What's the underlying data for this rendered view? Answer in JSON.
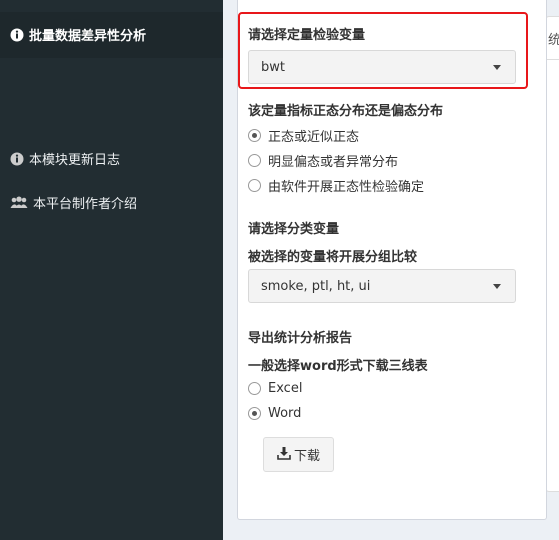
{
  "sidebar": {
    "items": [
      {
        "label": "批量数据差异性分析",
        "icon": "info-circle-icon"
      },
      {
        "label": "本模块更新日志",
        "icon": "info-circle-icon"
      },
      {
        "label": "本平台制作者介绍",
        "icon": "users-icon"
      }
    ]
  },
  "right_panel": {
    "tab_label": "统"
  },
  "quant_var": {
    "label": "请选择定量检验变量",
    "value": "bwt"
  },
  "distribution": {
    "label": "该定量指标正态分布还是偏态分布",
    "options": [
      {
        "label": "正态或近似正态",
        "checked": true
      },
      {
        "label": "明显偏态或者异常分布",
        "checked": false
      },
      {
        "label": "由软件开展正态性检验确定",
        "checked": false
      }
    ]
  },
  "group_var": {
    "label": "请选择分类变量",
    "sublabel": "被选择的变量将开展分组比较",
    "value": "smoke, ptl, ht, ui"
  },
  "report": {
    "label": "导出统计分析报告",
    "sublabel": "一般选择word形式下载三线表",
    "options": [
      {
        "label": "Excel",
        "checked": false
      },
      {
        "label": "Word",
        "checked": true
      }
    ],
    "download_label": "下载"
  },
  "colors": {
    "sidebar_bg": "#222d32",
    "highlight": "#e8171a",
    "page_bg": "#ecf0f5"
  }
}
